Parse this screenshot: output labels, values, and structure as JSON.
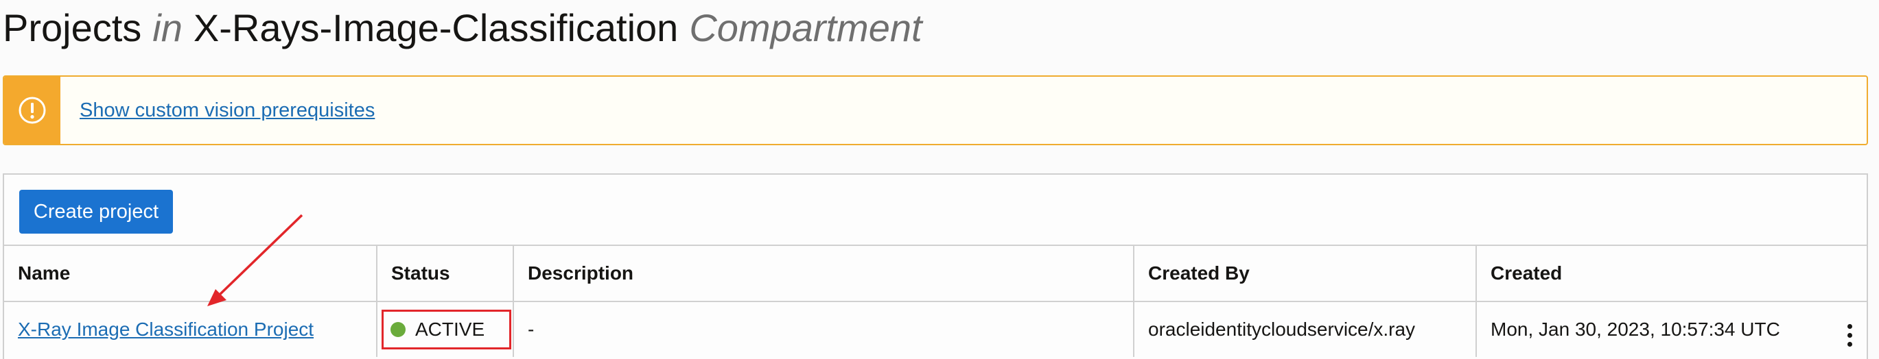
{
  "header": {
    "title_prefix": "Projects",
    "title_in": "in",
    "compartment_name": "X-Rays-Image-Classification",
    "title_suffix": "Compartment"
  },
  "notice": {
    "icon": "exclamation-circle-icon",
    "link_text": "Show custom vision prerequisites",
    "color": "#f4a92d"
  },
  "toolbar": {
    "create_label": "Create project"
  },
  "table": {
    "columns": [
      "Name",
      "Status",
      "Description",
      "Created By",
      "Created"
    ],
    "rows": [
      {
        "name": "X-Ray Image Classification Project",
        "status": "ACTIVE",
        "status_color": "#6aab3b",
        "description": "-",
        "created_by": "oracleidentitycloudservice/x.ray",
        "created": "Mon, Jan 30, 2023, 10:57:34 UTC",
        "actions_icon": "kebab-menu-icon"
      }
    ]
  },
  "annotations": {
    "arrow_color": "#e2262a",
    "highlight_box_color": "#e2262a"
  }
}
